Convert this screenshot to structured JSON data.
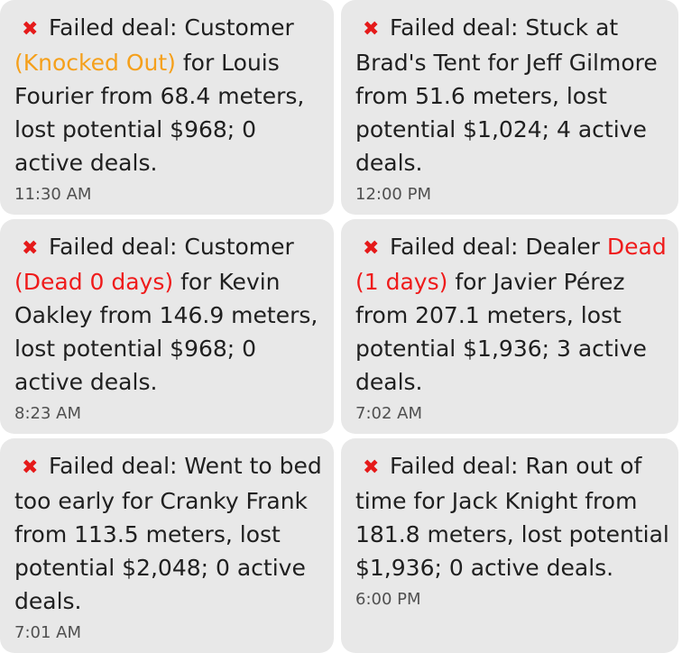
{
  "icon": "cross-mark-icon",
  "colors": {
    "icon": "#e51a1a",
    "orange": "#f5a01b",
    "red": "#ef1b1b",
    "card": "#e8e8e8"
  },
  "notifications": [
    {
      "prefix": "Failed deal: Customer",
      "highlight": "(Knocked Out)",
      "suffix": " for Louis Fourier from 68.4 meters, lost potential $968; 0 active deals.",
      "time": "11:30 AM"
    },
    {
      "prefix": "Failed deal: Stuck at Brad's Tent for Jeff Gilmore from 51.6 meters, lost potential $1,024; 4 active deals.",
      "highlight": "",
      "suffix": "",
      "time": "12:00 PM"
    },
    {
      "prefix": "Failed deal: Customer",
      "highlight": "(Dead 0 days)",
      "suffix": " for Kevin Oakley from 146.9 meters, lost potential $968; 0 active deals.",
      "time": "8:23 AM"
    },
    {
      "prefix": "Failed deal: Dealer",
      "highlight": "Dead (1 days)",
      "suffix": " for Javier Pérez from 207.1 meters, lost potential $1,936; 3 active deals.",
      "time": "7:02 AM"
    },
    {
      "prefix": "Failed deal: Went to bed too early for Cranky Frank from 113.5 meters, lost potential $2,048; 0 active deals.",
      "highlight": "",
      "suffix": "",
      "time": "7:01 AM"
    },
    {
      "prefix": "Failed deal: Ran out of time for Jack Knight from 181.8 meters, lost potential $1,936; 0 active deals.",
      "highlight": "",
      "suffix": "",
      "time": "6:00 PM"
    }
  ]
}
